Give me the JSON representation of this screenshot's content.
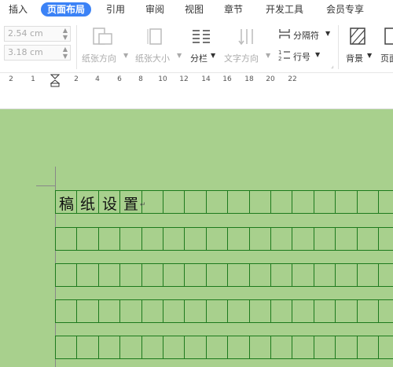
{
  "menu": {
    "items": [
      "插入",
      "页面布局",
      "引用",
      "审阅",
      "视图",
      "章节",
      "开发工具",
      "会员专享"
    ]
  },
  "ribbon": {
    "margin_top": "2.54 cm",
    "margin_bottom": "3.18 cm",
    "paper_direction": "纸张方向",
    "paper_size": "纸张大小",
    "columns": "分栏",
    "text_direction": "文字方向",
    "separator": "分隔符",
    "line_number": "行号",
    "background": "背景",
    "page_border": "页面"
  },
  "ruler": {
    "numbers": [
      "2",
      "1",
      "2",
      "4",
      "6",
      "8",
      "10",
      "12",
      "14",
      "16",
      "18",
      "20",
      "22"
    ]
  },
  "document": {
    "chars": [
      "稿",
      "纸",
      "设",
      "置"
    ]
  },
  "colors": {
    "page_background": "#a8d08d",
    "grid_line": "#1d7a1d",
    "active_tab": "#3b82f6"
  }
}
